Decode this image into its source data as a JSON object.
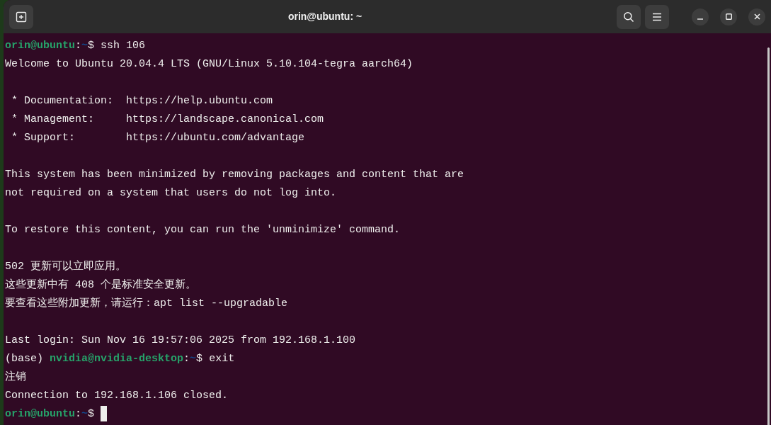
{
  "window": {
    "title": "orin@ubuntu: ~"
  },
  "lines": [
    {
      "kind": "prompt",
      "user": "orin@ubuntu",
      "separator": ":",
      "path": "~",
      "symbol": "$",
      "command": "ssh 106"
    },
    {
      "kind": "text",
      "text": "Welcome to Ubuntu 20.04.4 LTS (GNU/Linux 5.10.104-tegra aarch64)"
    },
    {
      "kind": "blank"
    },
    {
      "kind": "text",
      "text": " * Documentation:  https://help.ubuntu.com"
    },
    {
      "kind": "text",
      "text": " * Management:     https://landscape.canonical.com"
    },
    {
      "kind": "text",
      "text": " * Support:        https://ubuntu.com/advantage"
    },
    {
      "kind": "blank"
    },
    {
      "kind": "text",
      "text": "This system has been minimized by removing packages and content that are"
    },
    {
      "kind": "text",
      "text": "not required on a system that users do not log into."
    },
    {
      "kind": "blank"
    },
    {
      "kind": "text",
      "text": "To restore this content, you can run the 'unminimize' command."
    },
    {
      "kind": "blank"
    },
    {
      "kind": "text",
      "text": "502 更新可以立即应用。"
    },
    {
      "kind": "text",
      "text": "这些更新中有 408 个是标准安全更新。"
    },
    {
      "kind": "text",
      "text": "要查看这些附加更新，请运行：apt list --upgradable"
    },
    {
      "kind": "blank"
    },
    {
      "kind": "text",
      "text": "Last login: Sun Nov 16 19:57:06 2025 from 192.168.1.100"
    },
    {
      "kind": "prompt",
      "prefix": "(base)",
      "user": "nvidia@nvidia-desktop",
      "separator": ":",
      "path": "~",
      "symbol": "$",
      "command": "exit"
    },
    {
      "kind": "text",
      "text": "注销"
    },
    {
      "kind": "text",
      "text": "Connection to 192.168.1.106 closed."
    },
    {
      "kind": "prompt",
      "user": "orin@ubuntu",
      "separator": ":",
      "path": "~",
      "symbol": "$",
      "cursor": true
    }
  ]
}
